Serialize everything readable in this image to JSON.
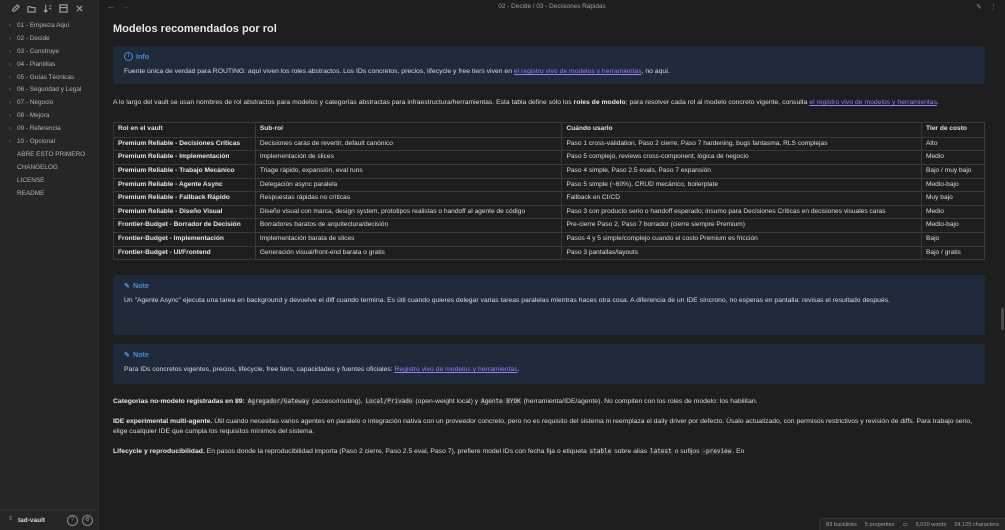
{
  "sidebar": {
    "toolbar_icons": [
      "new-note-icon",
      "new-folder-icon",
      "sort-icon",
      "collapse-icon",
      "close-icon"
    ],
    "items": [
      {
        "label": "01 - Empieza Aquí",
        "type": "folder"
      },
      {
        "label": "02 - Decide",
        "type": "folder"
      },
      {
        "label": "03 - Construye",
        "type": "folder"
      },
      {
        "label": "04 - Plantillas",
        "type": "folder"
      },
      {
        "label": "05 - Guías Técnicas",
        "type": "folder"
      },
      {
        "label": "06 - Seguridad y Legal",
        "type": "folder"
      },
      {
        "label": "07 - Negocio",
        "type": "folder"
      },
      {
        "label": "08 - Mejora",
        "type": "folder"
      },
      {
        "label": "09 - Referencia",
        "type": "folder"
      },
      {
        "label": "10 - Opcional",
        "type": "folder"
      },
      {
        "label": "ABRE ESTO PRIMERO",
        "type": "file"
      },
      {
        "label": "CHANGELOG",
        "type": "file"
      },
      {
        "label": "LICENSE",
        "type": "file"
      },
      {
        "label": "README",
        "type": "file"
      }
    ],
    "vault_name": "tad-vault"
  },
  "topbar": {
    "breadcrumb": "02 - Decide  /  03 - Decisiones Rápidas"
  },
  "main": {
    "title": "Modelos recomendados por rol",
    "info_callout": {
      "title": "Info",
      "body_pre": "Fuente única de verdad para ROUTING: aquí viven los roles abstractos. Los IDs concretos, precios, lifecycle y free tiers viven en ",
      "link": "el registro vivo de modelos y herramientas",
      "body_post": ", no aquí."
    },
    "intro": {
      "pre": "A lo largo del vault se usan nombres de rol abstractos para modelos y categorías abstractas para infraestructura/herramientas. Esta tabla define sólo los ",
      "bold": "roles de modelo",
      "mid": "; para resolver cada rol al modelo concreto vigente, consulta ",
      "link": "el registro vivo de modelos y herramientas",
      "post": "."
    },
    "table": {
      "headers": [
        "Rol en el vault",
        "Sub-rol",
        "Cuándo usarlo",
        "Tier de costo"
      ],
      "rows": [
        [
          "Premium Reliable - Decisiones Críticas",
          "Decisiones caras de revertir, default canónico",
          "Paso 1 cross-validation, Paso 2 cierre, Paso 7 hardening, bugs fantasma, RLS complejas",
          "Alto"
        ],
        [
          "Premium Reliable - Implementación",
          "Implementación de slices",
          "Paso 5 complejo, reviews cross-component, lógica de negocio",
          "Medio"
        ],
        [
          "Premium Reliable - Trabajo Mecánico",
          "Triage rápido, expansión, eval runs",
          "Paso 4 simple, Paso 2.5 evals, Paso 7 expansión",
          "Bajo / muy bajo"
        ],
        [
          "Premium Reliable - Agente Async",
          "Delegación async paralela",
          "Paso 5 simple (~60%), CRUD mecánico, boilerplate",
          "Medio-bajo"
        ],
        [
          "Premium Reliable - Fallback Rápido",
          "Respuestas rápidas no críticas",
          "Fallback en CI/CD",
          "Muy bajo"
        ],
        [
          "Premium Reliable - Diseño Visual",
          "Diseño visual con marca, design system, prototipos realistas o handoff al agente de código",
          "Paso 3 con producto serio o handoff esperado; insumo para Decisiones Críticas en decisiones visuales caras",
          "Medio"
        ],
        [
          "Frontier-Budget - Borrador de Decisión",
          "Borradores baratos de arquitectura/decisión",
          "Pre-cierre Paso 2, Paso 7 borrador (cierre siempre Premium)",
          "Medio-bajo"
        ],
        [
          "Frontier-Budget - Implementación",
          "Implementación barata de slices",
          "Pasos 4 y 5 simple/complejo cuando el costo Premium es fricción",
          "Bajo"
        ],
        [
          "Frontier-Budget - UI/Frontend",
          "Generación visual/front-end barata o gratis",
          "Paso 3 pantallas/layouts",
          "Bajo / gratis"
        ]
      ]
    },
    "note1": {
      "title": "Note",
      "body": "Un \"Agente Async\" ejecuta una tarea en background y devuelve el diff cuando termina. Es útil cuando quieres delegar varias tareas paralelas mientras haces otra cosa. A diferencia de un IDE síncrono, no esperas en pantalla: revisas el resultado después."
    },
    "note2": {
      "title": "Note",
      "body_pre": "Para IDs concretos vigentes, precios, lifecycle, free tiers, capacidades y fuentes oficiales: ",
      "link": "Registro vivo de modelos y herramientas",
      "body_post": "."
    },
    "categories": {
      "bold": "Categorías no-modelo registradas en 89:",
      "code1": "Agregador/Gateway",
      "t1": " (acceso/routing), ",
      "code2": "Local/Privado",
      "t2": " (open-weight local) y ",
      "code3": "Agente BYOK",
      "t3": " (herramienta/IDE/agente). No compiten con los roles de modelo: los habilitan."
    },
    "ide": {
      "bold": "IDE experimental multi-agente.",
      "text": " Útil cuando necesitas varios agentes en paralelo o integración nativa con un proveedor concreto, pero no es requisito del sistema ni reemplaza el daily driver por defecto. Úsalo actualizado, con permisos restrictivos y revisión de diffs. Para trabajo serio, elige cualquier IDE que cumpla los requisitos mínimos del sistema."
    },
    "lifecycle": {
      "bold": "Lifecycle y reproducibilidad.",
      "t1": " En pasos donde la reproducibilidad importa (Paso 2 cierre, Paso 2.5 eval, Paso 7), prefiere model IDs con fecha fija o etiqueta ",
      "code1": "stable",
      "t2": " sobre alias ",
      "code2": "latest",
      "t3": " o sufijos ",
      "code3": "-preview",
      "t4": ". En"
    }
  },
  "statusbar": {
    "backlinks": "83 backlinks",
    "properties": "5 properties",
    "words": "5,010 words",
    "characters": "34,125 characters"
  }
}
